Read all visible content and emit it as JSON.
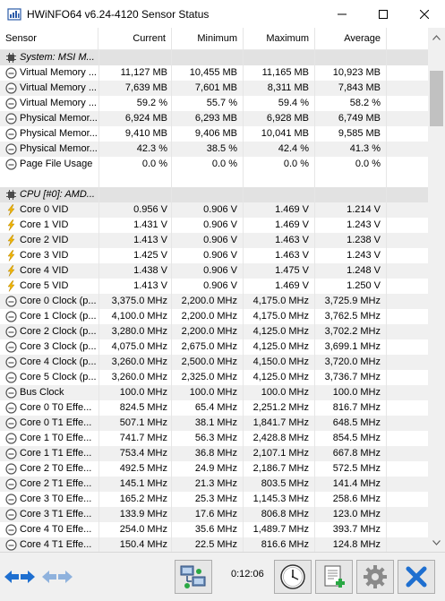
{
  "window": {
    "title": "HWiNFO64 v6.24-4120 Sensor Status"
  },
  "columns": {
    "sensor": "Sensor",
    "current": "Current",
    "minimum": "Minimum",
    "maximum": "Maximum",
    "average": "Average"
  },
  "rows": [
    {
      "type": "group",
      "name": "System: MSI M...",
      "icon": "chip-icon"
    },
    {
      "type": "data",
      "icon": "gauge-icon",
      "name": "Virtual Memory ...",
      "current": "11,127 MB",
      "minimum": "10,455 MB",
      "maximum": "11,165 MB",
      "average": "10,923 MB"
    },
    {
      "type": "data",
      "icon": "gauge-icon",
      "name": "Virtual Memory ...",
      "current": "7,639 MB",
      "minimum": "7,601 MB",
      "maximum": "8,311 MB",
      "average": "7,843 MB"
    },
    {
      "type": "data",
      "icon": "gauge-icon",
      "name": "Virtual Memory ...",
      "current": "59.2 %",
      "minimum": "55.7 %",
      "maximum": "59.4 %",
      "average": "58.2 %"
    },
    {
      "type": "data",
      "icon": "gauge-icon",
      "name": "Physical Memor...",
      "current": "6,924 MB",
      "minimum": "6,293 MB",
      "maximum": "6,928 MB",
      "average": "6,749 MB"
    },
    {
      "type": "data",
      "icon": "gauge-icon",
      "name": "Physical Memor...",
      "current": "9,410 MB",
      "minimum": "9,406 MB",
      "maximum": "10,041 MB",
      "average": "9,585 MB"
    },
    {
      "type": "data",
      "icon": "gauge-icon",
      "name": "Physical Memor...",
      "current": "42.3 %",
      "minimum": "38.5 %",
      "maximum": "42.4 %",
      "average": "41.3 %"
    },
    {
      "type": "data",
      "icon": "gauge-icon",
      "name": "Page File Usage",
      "current": "0.0 %",
      "minimum": "0.0 %",
      "maximum": "0.0 %",
      "average": "0.0 %"
    },
    {
      "type": "blank"
    },
    {
      "type": "group",
      "name": "CPU [#0]: AMD...",
      "icon": "chip-icon"
    },
    {
      "type": "data",
      "icon": "lightning-icon",
      "name": "Core 0 VID",
      "current": "0.956 V",
      "minimum": "0.906 V",
      "maximum": "1.469 V",
      "average": "1.214 V"
    },
    {
      "type": "data",
      "icon": "lightning-icon",
      "name": "Core 1 VID",
      "current": "1.431 V",
      "minimum": "0.906 V",
      "maximum": "1.469 V",
      "average": "1.243 V"
    },
    {
      "type": "data",
      "icon": "lightning-icon",
      "name": "Core 2 VID",
      "current": "1.413 V",
      "minimum": "0.906 V",
      "maximum": "1.463 V",
      "average": "1.238 V"
    },
    {
      "type": "data",
      "icon": "lightning-icon",
      "name": "Core 3 VID",
      "current": "1.425 V",
      "minimum": "0.906 V",
      "maximum": "1.463 V",
      "average": "1.243 V"
    },
    {
      "type": "data",
      "icon": "lightning-icon",
      "name": "Core 4 VID",
      "current": "1.438 V",
      "minimum": "0.906 V",
      "maximum": "1.475 V",
      "average": "1.248 V"
    },
    {
      "type": "data",
      "icon": "lightning-icon",
      "name": "Core 5 VID",
      "current": "1.413 V",
      "minimum": "0.906 V",
      "maximum": "1.469 V",
      "average": "1.250 V"
    },
    {
      "type": "data",
      "icon": "gauge-icon",
      "name": "Core 0 Clock (p...",
      "current": "3,375.0 MHz",
      "minimum": "2,200.0 MHz",
      "maximum": "4,175.0 MHz",
      "average": "3,725.9 MHz"
    },
    {
      "type": "data",
      "icon": "gauge-icon",
      "name": "Core 1 Clock (p...",
      "current": "4,100.0 MHz",
      "minimum": "2,200.0 MHz",
      "maximum": "4,175.0 MHz",
      "average": "3,762.5 MHz"
    },
    {
      "type": "data",
      "icon": "gauge-icon",
      "name": "Core 2 Clock (p...",
      "current": "3,280.0 MHz",
      "minimum": "2,200.0 MHz",
      "maximum": "4,125.0 MHz",
      "average": "3,702.2 MHz"
    },
    {
      "type": "data",
      "icon": "gauge-icon",
      "name": "Core 3 Clock (p...",
      "current": "4,075.0 MHz",
      "minimum": "2,675.0 MHz",
      "maximum": "4,125.0 MHz",
      "average": "3,699.1 MHz"
    },
    {
      "type": "data",
      "icon": "gauge-icon",
      "name": "Core 4 Clock (p...",
      "current": "3,260.0 MHz",
      "minimum": "2,500.0 MHz",
      "maximum": "4,150.0 MHz",
      "average": "3,720.0 MHz"
    },
    {
      "type": "data",
      "icon": "gauge-icon",
      "name": "Core 5 Clock (p...",
      "current": "3,260.0 MHz",
      "minimum": "2,325.0 MHz",
      "maximum": "4,125.0 MHz",
      "average": "3,736.7 MHz"
    },
    {
      "type": "data",
      "icon": "gauge-icon",
      "name": "Bus Clock",
      "current": "100.0 MHz",
      "minimum": "100.0 MHz",
      "maximum": "100.0 MHz",
      "average": "100.0 MHz"
    },
    {
      "type": "data",
      "icon": "gauge-icon",
      "name": "Core 0 T0 Effe...",
      "current": "824.5 MHz",
      "minimum": "65.4 MHz",
      "maximum": "2,251.2 MHz",
      "average": "816.7 MHz"
    },
    {
      "type": "data",
      "icon": "gauge-icon",
      "name": "Core 0 T1 Effe...",
      "current": "507.1 MHz",
      "minimum": "38.1 MHz",
      "maximum": "1,841.7 MHz",
      "average": "648.5 MHz"
    },
    {
      "type": "data",
      "icon": "gauge-icon",
      "name": "Core 1 T0 Effe...",
      "current": "741.7 MHz",
      "minimum": "56.3 MHz",
      "maximum": "2,428.8 MHz",
      "average": "854.5 MHz"
    },
    {
      "type": "data",
      "icon": "gauge-icon",
      "name": "Core 1 T1 Effe...",
      "current": "753.4 MHz",
      "minimum": "36.8 MHz",
      "maximum": "2,107.1 MHz",
      "average": "667.8 MHz"
    },
    {
      "type": "data",
      "icon": "gauge-icon",
      "name": "Core 2 T0 Effe...",
      "current": "492.5 MHz",
      "minimum": "24.9 MHz",
      "maximum": "2,186.7 MHz",
      "average": "572.5 MHz"
    },
    {
      "type": "data",
      "icon": "gauge-icon",
      "name": "Core 2 T1 Effe...",
      "current": "145.1 MHz",
      "minimum": "21.3 MHz",
      "maximum": "803.5 MHz",
      "average": "141.4 MHz"
    },
    {
      "type": "data",
      "icon": "gauge-icon",
      "name": "Core 3 T0 Effe...",
      "current": "165.2 MHz",
      "minimum": "25.3 MHz",
      "maximum": "1,145.3 MHz",
      "average": "258.6 MHz"
    },
    {
      "type": "data",
      "icon": "gauge-icon",
      "name": "Core 3 T1 Effe...",
      "current": "133.9 MHz",
      "minimum": "17.6 MHz",
      "maximum": "806.8 MHz",
      "average": "123.0 MHz"
    },
    {
      "type": "data",
      "icon": "gauge-icon",
      "name": "Core 4 T0 Effe...",
      "current": "254.0 MHz",
      "minimum": "35.6 MHz",
      "maximum": "1,489.7 MHz",
      "average": "393.7 MHz"
    },
    {
      "type": "data",
      "icon": "gauge-icon",
      "name": "Core 4 T1 Effe...",
      "current": "150.4 MHz",
      "minimum": "22.5 MHz",
      "maximum": "816.6 MHz",
      "average": "124.8 MHz"
    }
  ],
  "toolbar": {
    "elapsed_time": "0:12:06"
  },
  "colors": {
    "accent_blue": "#1e6fd0",
    "close_red": "#d93030",
    "bolt_yellow": "#f2b600",
    "group_bg": "#e2e2e2",
    "alt_row_bg": "#f0f0f0"
  }
}
